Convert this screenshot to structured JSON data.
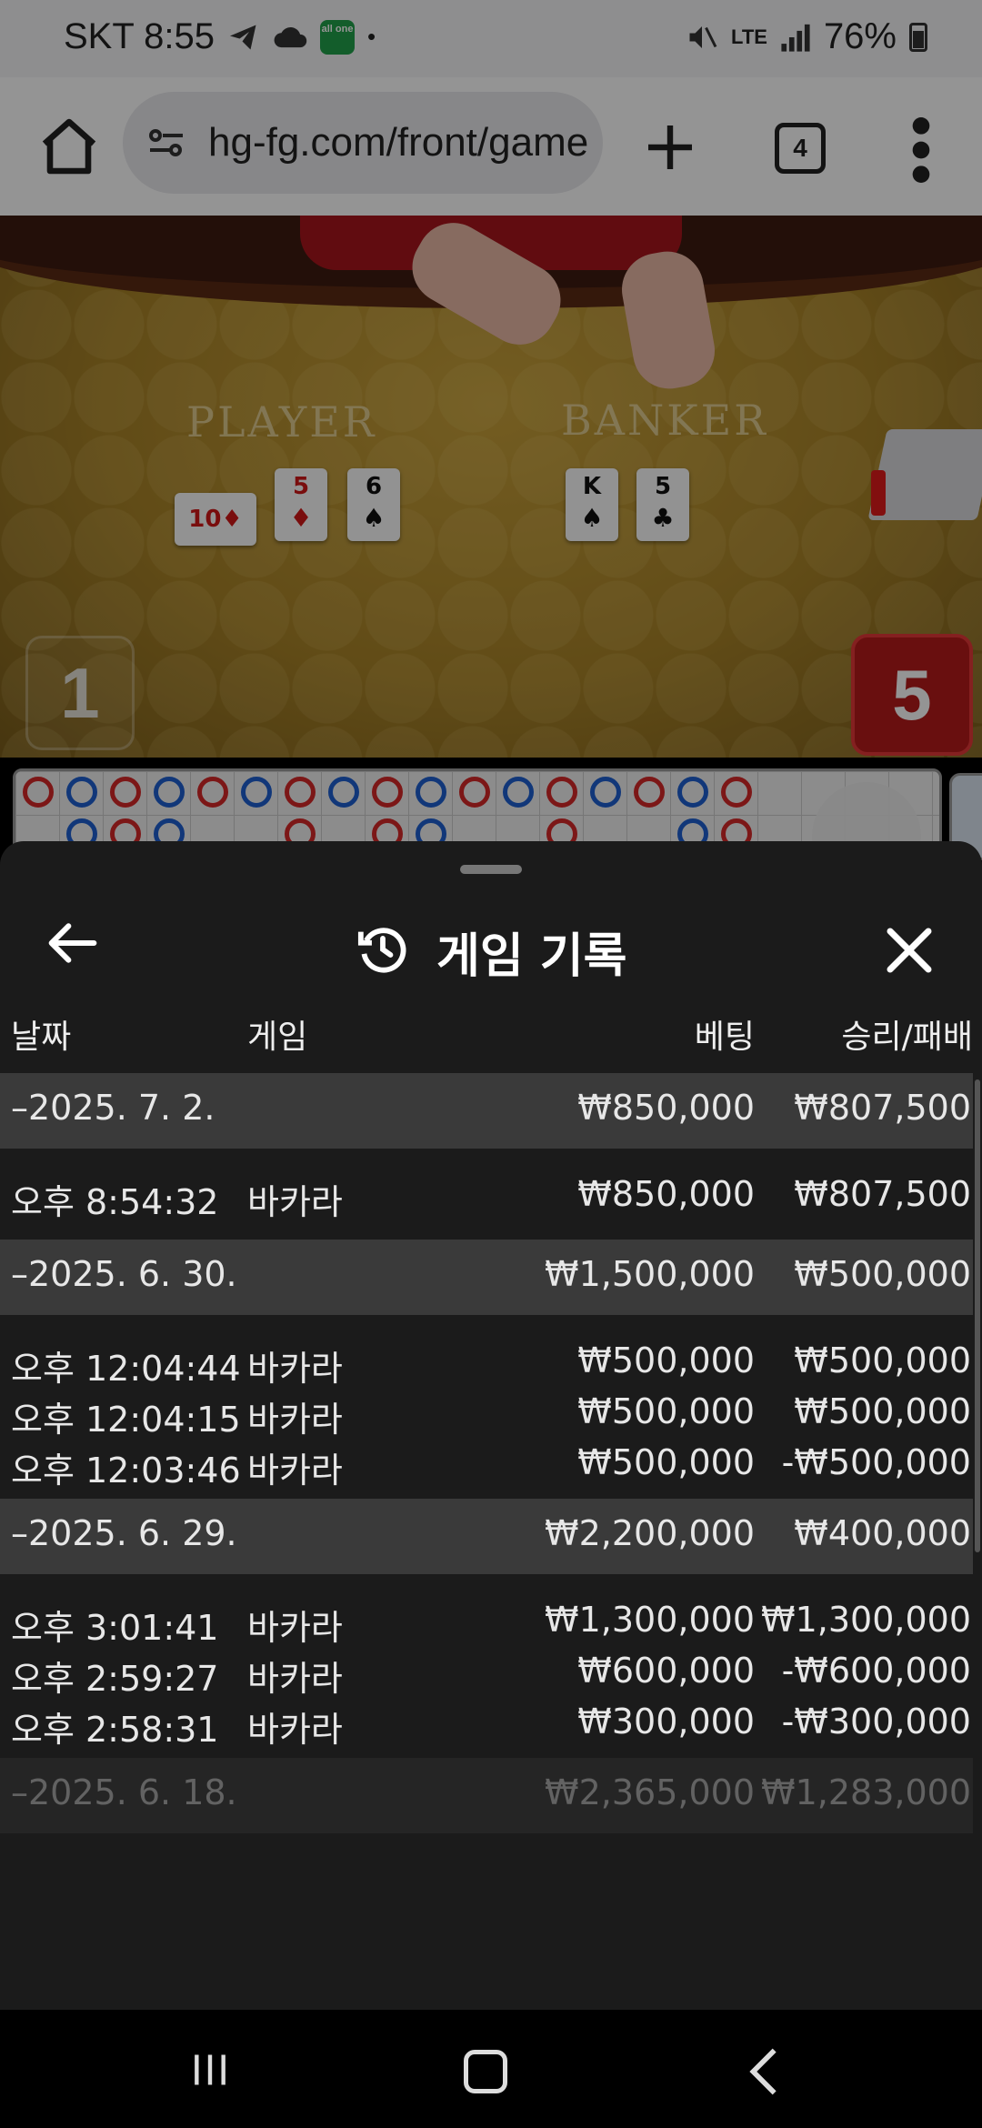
{
  "status_bar": {
    "carrier_time": "SKT 8:55",
    "app_badge": "all one",
    "dot": "•",
    "network": "LTE",
    "battery": "76%"
  },
  "browser": {
    "url": "hg-fg.com/front/game",
    "tab_count": "4"
  },
  "game": {
    "player_label": "PLAYER",
    "banker_label": "BANKER",
    "player_cards": [
      {
        "rank": "10",
        "suit": "♦",
        "color": "red"
      },
      {
        "rank": "5",
        "suit": "♦",
        "color": "red"
      },
      {
        "rank": "6",
        "suit": "♠",
        "color": "black"
      }
    ],
    "banker_cards": [
      {
        "rank": "K",
        "suit": "♠",
        "color": "black"
      },
      {
        "rank": "5",
        "suit": "♣",
        "color": "black"
      }
    ],
    "player_score": "1",
    "banker_score": "5"
  },
  "history": {
    "title": "게임 기록",
    "columns": {
      "date": "날짜",
      "game": "게임",
      "bet": "베팅",
      "winloss": "승리/패배"
    },
    "groups": [
      {
        "date": "–2025. 7. 2.",
        "bet": "₩850,000",
        "winloss": "₩807,500",
        "items": [
          {
            "time": "오후 8:54:32",
            "game": "바카라",
            "bet": "₩850,000",
            "winloss": "₩807,500"
          }
        ]
      },
      {
        "date": "–2025. 6. 30.",
        "bet": "₩1,500,000",
        "winloss": "₩500,000",
        "items": [
          {
            "time": "오후 12:04:44",
            "game": "바카라",
            "bet": "₩500,000",
            "winloss": "₩500,000"
          },
          {
            "time": "오후 12:04:15",
            "game": "바카라",
            "bet": "₩500,000",
            "winloss": "₩500,000"
          },
          {
            "time": "오후 12:03:46",
            "game": "바카라",
            "bet": "₩500,000",
            "winloss": "-₩500,000"
          }
        ]
      },
      {
        "date": "–2025. 6. 29.",
        "bet": "₩2,200,000",
        "winloss": "₩400,000",
        "items": [
          {
            "time": "오후 3:01:41",
            "game": "바카라",
            "bet": "₩1,300,000",
            "winloss": "₩1,300,000"
          },
          {
            "time": "오후 2:59:27",
            "game": "바카라",
            "bet": "₩600,000",
            "winloss": "-₩600,000"
          },
          {
            "time": "오후 2:58:31",
            "game": "바카라",
            "bet": "₩300,000",
            "winloss": "-₩300,000"
          }
        ]
      },
      {
        "date": "–2025. 6. 18.",
        "bet": "₩2,365,000",
        "winloss": "₩1,283,000",
        "items": []
      }
    ]
  },
  "colors": {
    "sheet_bg": "#1b1b1b",
    "group_row_bg": "#3a3a3a",
    "banker_red": "#b51a1a",
    "player_blue": "#1e5fd1"
  }
}
